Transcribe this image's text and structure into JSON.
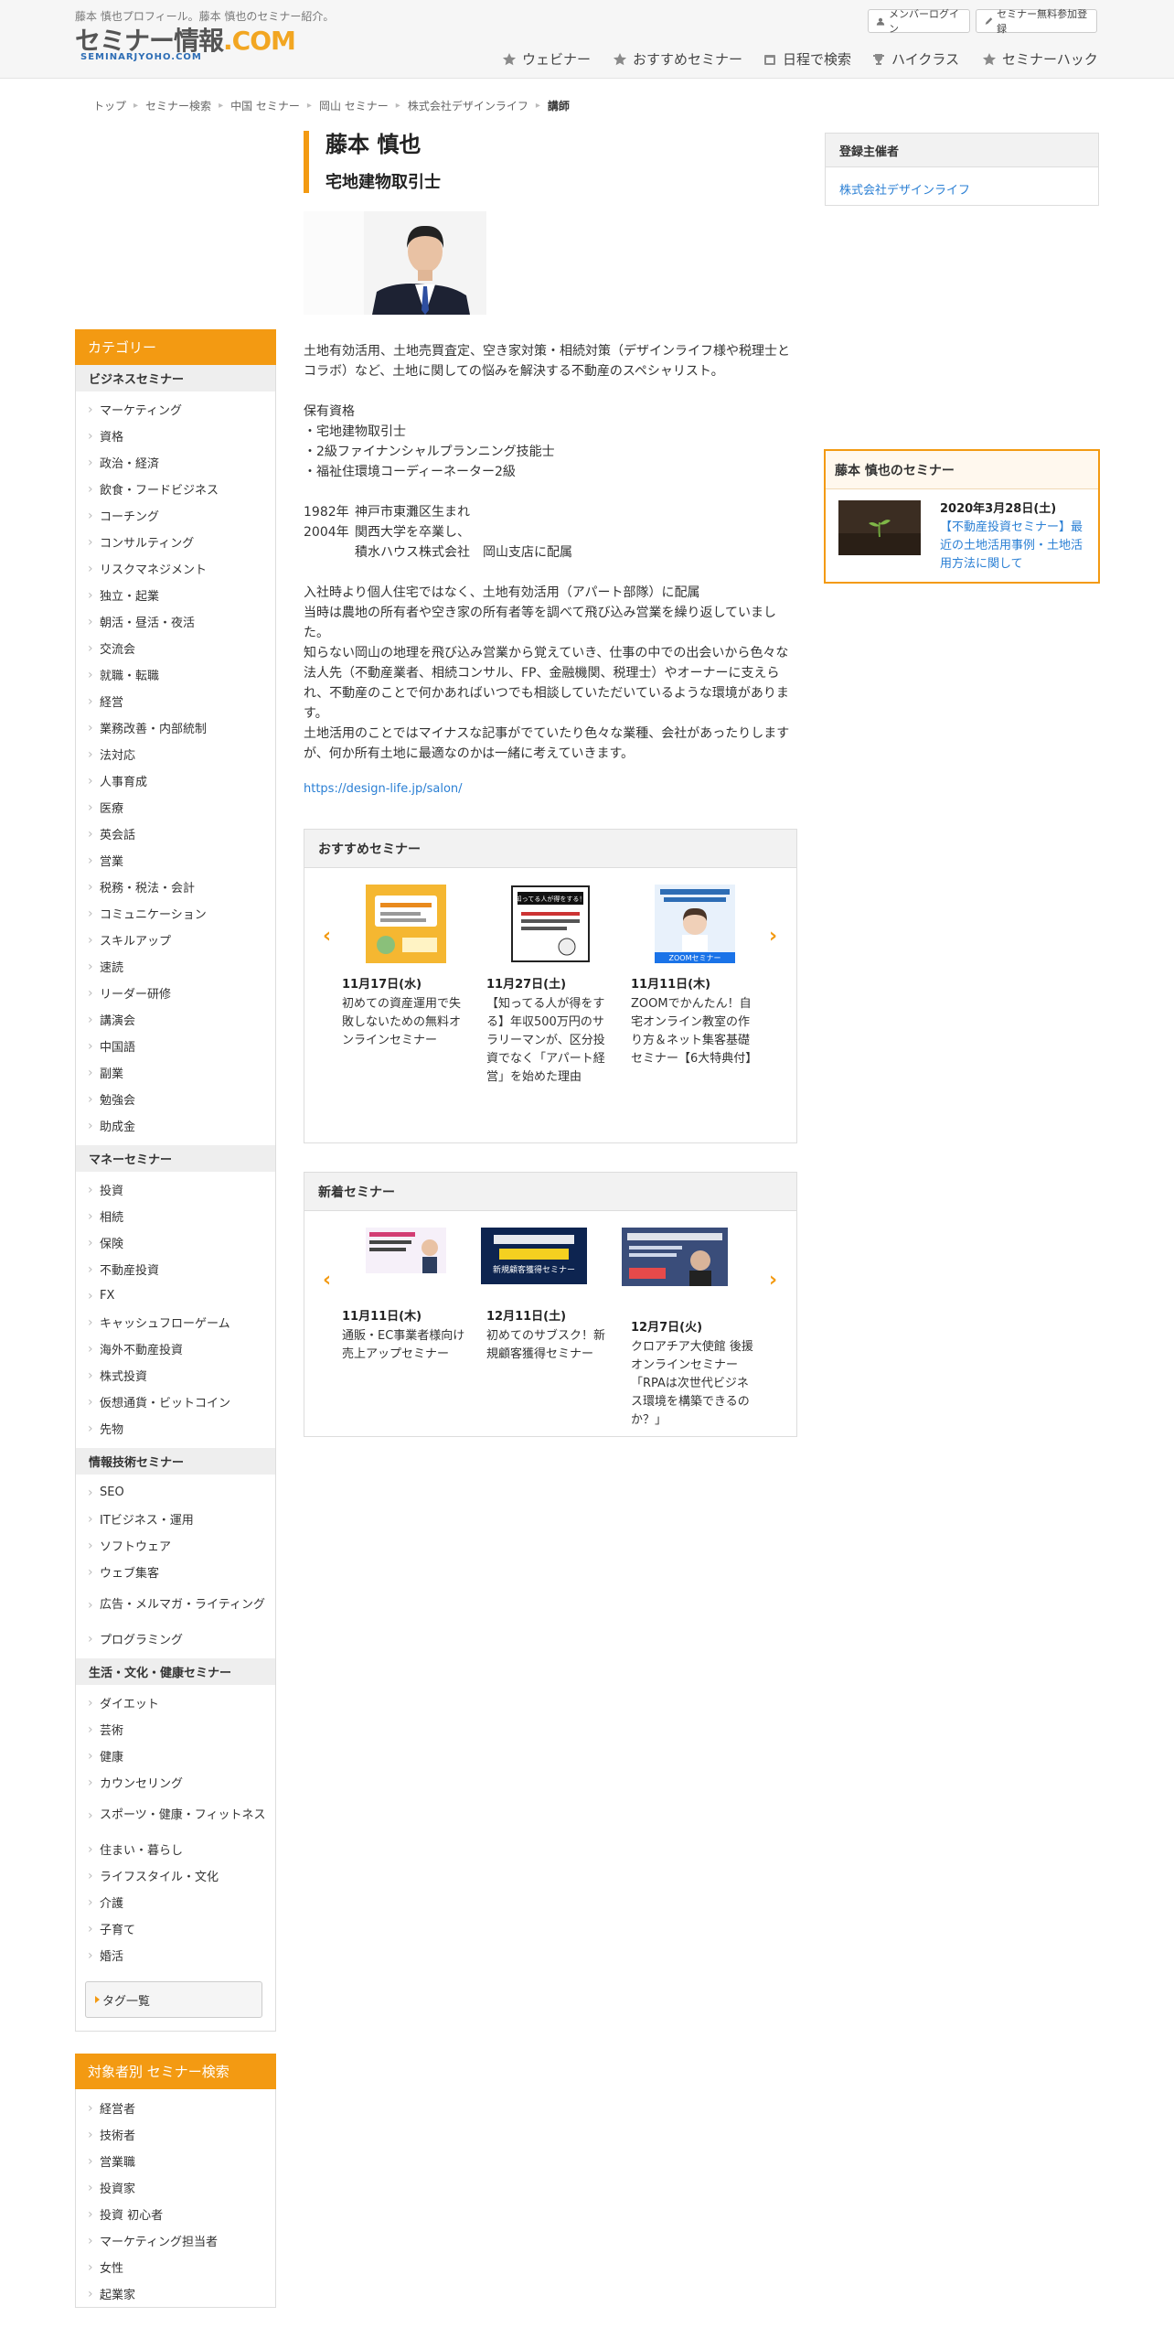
{
  "header": {
    "tagline": "藤本 慎也プロフィール。藤本 慎也のセミナー紹介。",
    "logo": {
      "main": "セミナー情報",
      "com": ".COM",
      "sub": "SEMINARJYOHO.COM"
    },
    "member_login": "メンバーログイン",
    "free_register": "セミナー無料参加登録",
    "nav": [
      {
        "label": "ウェビナー",
        "icon": "star-icon"
      },
      {
        "label": "おすすめセミナー",
        "icon": "star-icon"
      },
      {
        "label": "日程で検索",
        "icon": "calendar-icon"
      },
      {
        "label": "ハイクラス",
        "icon": "trophy-icon"
      },
      {
        "label": "セミナーハック",
        "icon": "star-icon"
      }
    ]
  },
  "breadcrumb": [
    "トップ",
    "セミナー検索",
    "中国 セミナー",
    "岡山 セミナー",
    "株式会社デザインライフ",
    "講師"
  ],
  "profile": {
    "name": "藤本 慎也",
    "title": "宅地建物取引士",
    "intro": "土地有効活用、土地売買査定、空き家対策・相続対策（デザインライフ様や税理士とコラボ）など、土地に関しての悩みを解決する不動産のスペシャリスト。",
    "qual_heading": "保有資格",
    "quals": [
      "・宅地建物取引士",
      "・2級ファイナンシャルプランニング技能士",
      "・福祉住環境コーディーネーター2級"
    ],
    "history": [
      {
        "year": "1982年",
        "text": "神戸市東灘区生まれ"
      },
      {
        "year": "2004年",
        "text": "関西大学を卒業し、"
      },
      {
        "year": "",
        "text": "積水ハウス株式会社　岡山支店に配属"
      }
    ],
    "career": [
      "入社時より個人住宅ではなく、土地有効活用（アパート部隊）に配属",
      "当時は農地の所有者や空き家の所有者等を調べて飛び込み営業を繰り返していました。",
      "知らない岡山の地理を飛び込み営業から覚えていき、仕事の中での出会いから色々な法人先（不動産業者、相続コンサル、FP、金融機関、税理士）やオーナーに支えられ、不動産のことで何かあればいつでも相談していただいているような環境があります。",
      "土地活用のことではマイナスな記事がでていたり色々な業種、会社があったりしますが、何か所有土地に最適なのかは一緒に考えていきます。"
    ],
    "url": "https://design-life.jp/salon/"
  },
  "recommended": {
    "heading": "おすすめセミナー",
    "items": [
      {
        "date": "11月17日(水)",
        "title": "初めての資産運用で失敗しないための無料オンラインセミナー"
      },
      {
        "date": "11月27日(土)",
        "title": "【知ってる人が得をする】年収500万円のサラリーマンが、区分投資でなく「アパート経営」を始めた理由"
      },
      {
        "date": "11月11日(木)",
        "title": "ZOOMでかんたん！自宅オンライン教室の作り方＆ネット集客基礎セミナー【6大特典付】"
      }
    ]
  },
  "new_seminars": {
    "heading": "新着セミナー",
    "items": [
      {
        "date": "11月11日(木)",
        "title": "通販・EC事業者様向け売上アップセミナー"
      },
      {
        "date": "12月11日(土)",
        "title": "初めてのサブスク！新規顧客獲得セミナー"
      },
      {
        "date": "12月7日(火)",
        "title": "クロアチア大使館 後援 オンラインセミナー「RPAは次世代ビジネス環境を構築できるのか？」"
      }
    ]
  },
  "thumb_text": {
    "rec2": "知ってる人が得をする！",
    "rec3": "ZOOMセミナー",
    "new2": "新規顧客獲得セミナー"
  },
  "sidebar": {
    "category_heading": "カテゴリー",
    "groups": [
      {
        "name": "ビジネスセミナー",
        "items": [
          "マーケティング",
          "資格",
          "政治・経済",
          "飲食・フードビジネス",
          "コーチング",
          "コンサルティング",
          "リスクマネジメント",
          "独立・起業",
          "朝活・昼活・夜活",
          "交流会",
          "就職・転職",
          "経営",
          "業務改善・内部統制",
          "法対応",
          "人事育成",
          "医療",
          "英会話",
          "営業",
          "税務・税法・会計",
          "コミュニケーション",
          "スキルアップ",
          "速読",
          "リーダー研修",
          "講演会",
          "中国語",
          "副業",
          "勉強会",
          "助成金"
        ]
      },
      {
        "name": "マネーセミナー",
        "items": [
          "投資",
          "相続",
          "保険",
          "不動産投資",
          "FX",
          "キャッシュフローゲーム",
          "海外不動産投資",
          "株式投資",
          "仮想通貨・ビットコイン",
          "先物"
        ]
      },
      {
        "name": "情報技術セミナー",
        "items": [
          "SEO",
          "ITビジネス・運用",
          "ソフトウェア",
          "ウェブ集客",
          "広告・メルマガ・ライティング",
          "プログラミング"
        ]
      },
      {
        "name": "生活・文化・健康セミナー",
        "items": [
          "ダイエット",
          "芸術",
          "健康",
          "カウンセリング",
          "スポーツ・健康・フィットネス",
          "住まい・暮らし",
          "ライフスタイル・文化",
          "介護",
          "子育て",
          "婚活"
        ]
      }
    ],
    "tag_button": "タグ一覧",
    "target_heading": "対象者別 セミナー検索",
    "targets": [
      "経営者",
      "技術者",
      "営業職",
      "投資家",
      "投資 初心者",
      "マーケティング担当者",
      "女性",
      "起業家"
    ]
  },
  "organizer": {
    "heading": "登録主催者",
    "name": "株式会社デザインライフ"
  },
  "speaker_seminars": {
    "heading": "藤本 慎也のセミナー",
    "date": "2020年3月28日(土)",
    "title": "【不動産投資セミナー】最近の土地活用事例・土地活用方法に関して"
  },
  "colors": {
    "accent": "#f39a12",
    "link": "#2a7fd4"
  }
}
